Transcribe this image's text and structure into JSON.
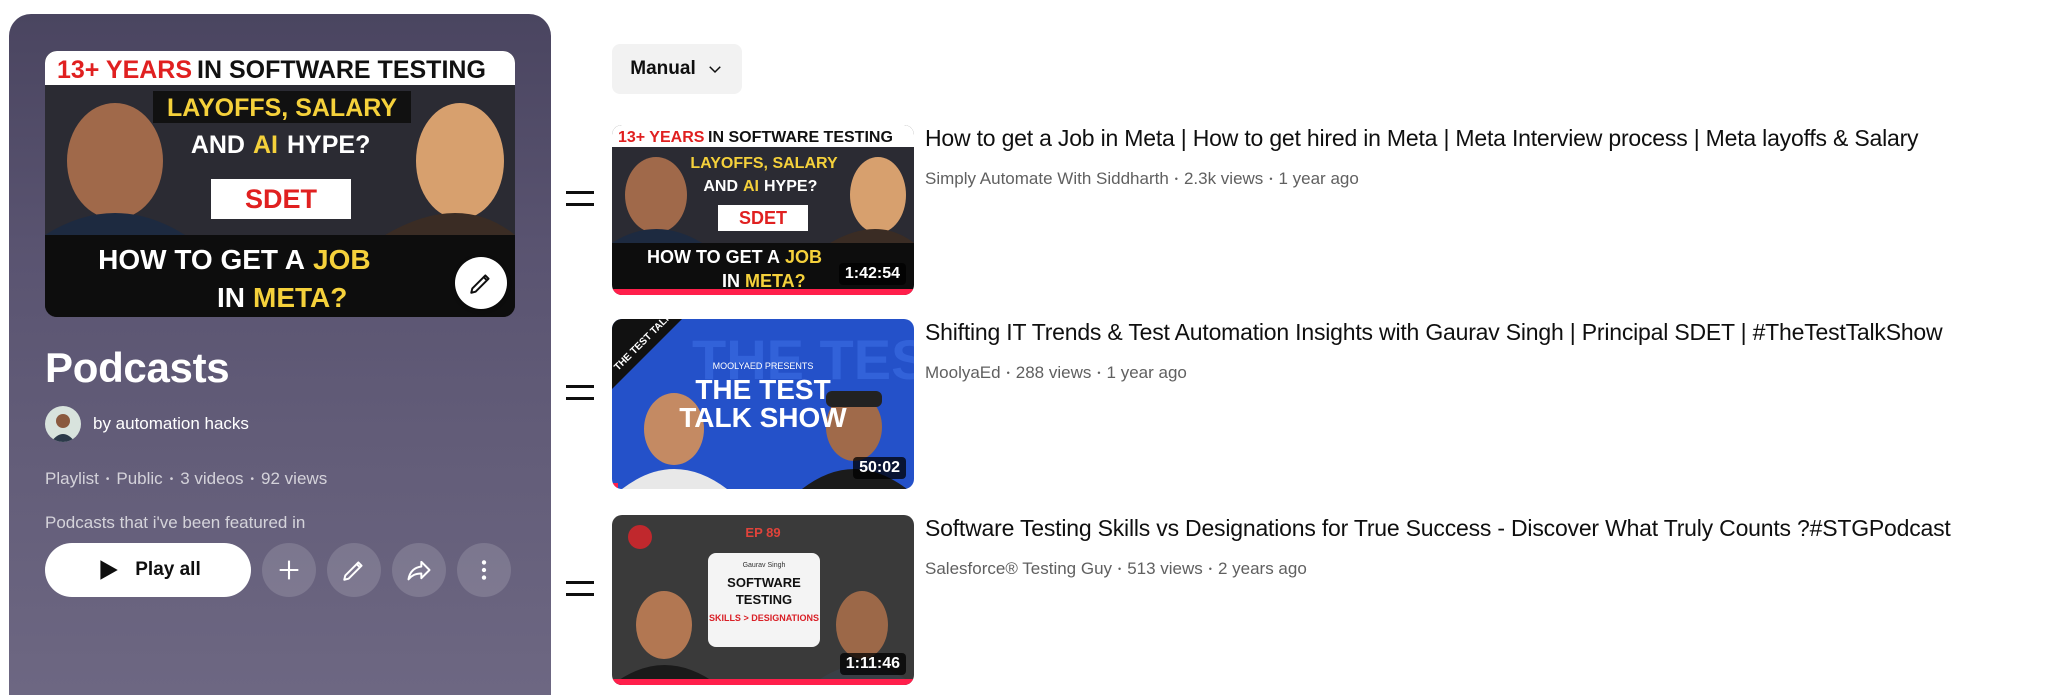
{
  "playlist": {
    "title": "Podcasts",
    "owner": "by automation hacks",
    "meta": [
      "Playlist",
      "Public",
      "3 videos",
      "92 views"
    ],
    "description": "Podcasts that i've been featured in",
    "play_all_label": "Play all",
    "hero": {
      "line1_red": "13+ YEARS",
      "line1_rest": "IN SOFTWARE TESTING",
      "line2": "LAYOFFS, SALARY",
      "line3_pre": "AND",
      "line3_hl": "AI",
      "line3_post": "HYPE?",
      "badge": "SDET",
      "line4_pre": "HOW TO GET A",
      "line4_hl": "JOB",
      "line5_pre": "IN",
      "line5_hl": "META?"
    }
  },
  "sort": {
    "label": "Manual"
  },
  "videos": [
    {
      "title": "How to get a Job in Meta | How to get hired in Meta | Meta Interview process | Meta layoffs & Salary",
      "channel": "Simply Automate With Siddharth",
      "views": "2.3k views",
      "age": "1 year ago",
      "duration": "1:42:54",
      "progress": 1.0,
      "thumb": {
        "line1_red": "13+ YEARS",
        "line1_rest": "IN SOFTWARE TESTING",
        "line2": "LAYOFFS, SALARY",
        "line3_pre": "AND",
        "line3_hl": "AI",
        "line3_post": "HYPE?",
        "badge": "SDET",
        "line4_pre": "HOW TO GET A",
        "line4_hl": "JOB",
        "line5_pre": "IN",
        "line5_hl": "META?"
      }
    },
    {
      "title": "Shifting IT Trends & Test Automation Insights with Gaurav Singh | Principal SDET | #TheTestTalkShow",
      "channel": "MoolyaEd",
      "views": "288 views",
      "age": "1 year ago",
      "duration": "50:02",
      "progress": 0.02,
      "thumb": {
        "corner": "THE TEST TALK SHOW",
        "presents": "MOOLYAED PRESENTS",
        "line1": "THE TEST",
        "line2": "TALK SHOW"
      }
    },
    {
      "title": "Software Testing Skills vs Designations for True Success - Discover What Truly Counts ?#STGPodcast",
      "channel": "Salesforce® Testing Guy",
      "views": "513 views",
      "age": "2 years ago",
      "duration": "1:11:46",
      "progress": 1.0,
      "thumb": {
        "ep": "EP 89",
        "host": "Gaurav Singh",
        "line1": "SOFTWARE",
        "line2": "TESTING",
        "line3": "SKILLS > DESIGNATIONS"
      }
    }
  ],
  "colors": {
    "accent": "#ff1f4b",
    "panel": "#5a5471"
  }
}
